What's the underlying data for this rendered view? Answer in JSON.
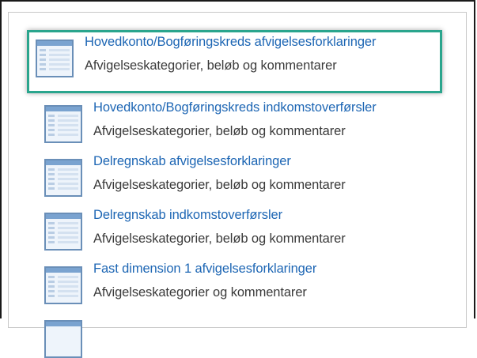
{
  "list": {
    "items": [
      {
        "title": "Hovedkonto/Bogføringskreds afvigelsesforklaringer",
        "description": "Afvigelseskategorier, beløb og kommentarer",
        "icon": "report-list-icon",
        "selected": true
      },
      {
        "title": "Hovedkonto/Bogføringskreds indkomstoverførsler",
        "description": "Afvigelseskategorier, beløb og kommentarer",
        "icon": "report-list-icon"
      },
      {
        "title": "Delregnskab afvigelsesforklaringer",
        "description": "Afvigelseskategorier, beløb og kommentarer",
        "icon": "report-list-icon"
      },
      {
        "title": "Delregnskab indkomstoverførsler",
        "description": "Afvigelseskategorier, beløb og kommentarer",
        "icon": "report-list-icon"
      },
      {
        "title": "Fast dimension 1 afvigelsesforklaringer",
        "description": "Afvigelseskategorier og kommentarer",
        "icon": "report-list-icon"
      }
    ]
  },
  "colors": {
    "link": "#1d66b4",
    "description": "#3a3a3a",
    "selection_border": "#2aa58d"
  }
}
